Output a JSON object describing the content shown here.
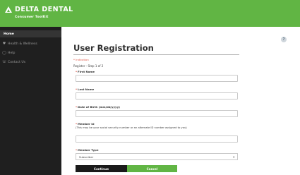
{
  "brand": {
    "name": "DELTA DENTAL",
    "subtitle": "Consumer ToolKit"
  },
  "sidebar": {
    "items": [
      {
        "label": "Home",
        "icon": "home-icon",
        "active": true
      },
      {
        "label": "Health & Wellness",
        "icon": "heart-icon",
        "active": false
      },
      {
        "label": "Help",
        "icon": "help-circle-icon",
        "active": false
      },
      {
        "label": "Contact Us",
        "icon": "phone-icon",
        "active": false
      }
    ]
  },
  "page": {
    "title": "User Registration",
    "required_note": "* Indication",
    "step": "Register - Step 1 of 2",
    "help_icon": "help-icon"
  },
  "form": {
    "first_name": {
      "label": "First Name",
      "value": ""
    },
    "last_name": {
      "label": "Last Name",
      "value": ""
    },
    "dob": {
      "label": "Date of Birth (mm/dd/yyyy)",
      "value": ""
    },
    "member_id": {
      "label": "Member Id",
      "note": "(This may be your social security number or an alternate ID number assigned to you)",
      "value": ""
    },
    "member_type": {
      "label": "Member Type",
      "selected": "Subscriber"
    }
  },
  "buttons": {
    "continue": "Continue",
    "cancel": "Cancel"
  },
  "colors": {
    "brand_green": "#61b544",
    "sidebar_bg": "#1f1f1f",
    "required_red": "#e04b3b"
  }
}
